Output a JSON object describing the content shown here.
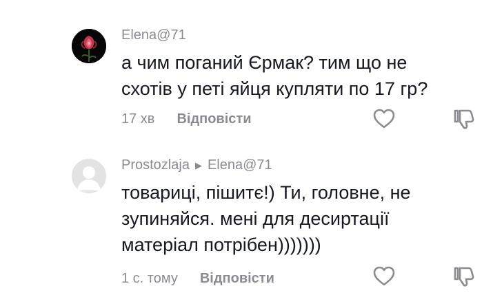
{
  "comments": [
    {
      "author": "Elena@71",
      "avatar": "flower-avatar",
      "text_lines": [
        "а чим поганий Єрмак? тим що не",
        "схотів у петі яйця купляти по 17 гр?"
      ],
      "time": "17 хв",
      "reply_label": "Відповісти",
      "icons": {
        "like": "heart-outline-icon",
        "dislike": "thumbs-down-icon"
      }
    },
    {
      "author": "Prostozlaja",
      "reply_to": "Elena@71",
      "avatar": "default-avatar",
      "text_lines": [
        "товариці, пішитє!) Ти, головне, не",
        "зупиняйся. мені для десиртації",
        "матеріал потрібен)))))))"
      ],
      "time": "1 с. тому",
      "reply_label": "Відповісти",
      "icons": {
        "like": "heart-outline-icon",
        "dislike": "thumbs-down-icon"
      }
    }
  ],
  "colors": {
    "text": "#161823",
    "secondary": "#8a8b91",
    "background": "#ffffff"
  }
}
